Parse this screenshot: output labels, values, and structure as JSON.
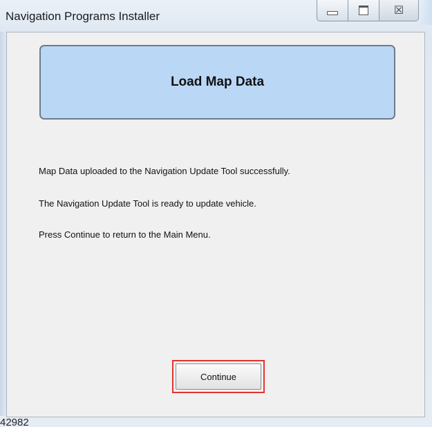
{
  "window": {
    "title": "Navigation Programs Installer",
    "caption_buttons": [
      {
        "name": "minimize",
        "icon": "minimize-icon"
      },
      {
        "name": "maximize",
        "icon": "maximize-icon"
      },
      {
        "name": "close",
        "icon": "close-icon",
        "glyph": "☒"
      }
    ]
  },
  "banner": {
    "title": "Load Map Data"
  },
  "messages": {
    "line1": "Map Data uploaded to the Navigation Update Tool successfully.",
    "line2": "The Navigation Update Tool is ready to update vehicle.",
    "line3": "Press Continue to return to the Main Menu."
  },
  "actions": {
    "continue_label": "Continue",
    "highlight_color": "#e5322d"
  },
  "footer": {
    "figure_id": "42982"
  },
  "colors": {
    "banner_fill": "#bad7f5",
    "banner_border": "#6d7b8a",
    "client_bg": "#f0f0f0"
  }
}
